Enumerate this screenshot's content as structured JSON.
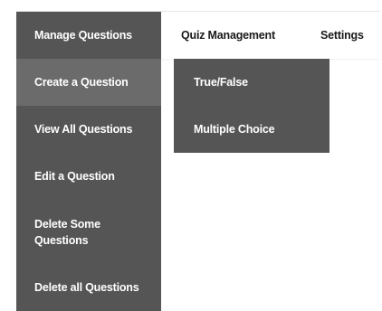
{
  "nav": {
    "items": [
      {
        "label": "Manage Questions"
      },
      {
        "label": "Quiz Management"
      },
      {
        "label": "Settings"
      }
    ]
  },
  "dropdown": {
    "items": [
      {
        "label": "Create a Question"
      },
      {
        "label": "View All Questions"
      },
      {
        "label": "Edit a Question"
      },
      {
        "label": "Delete Some Questions"
      },
      {
        "label": "Delete all Questions"
      }
    ]
  },
  "submenu": {
    "items": [
      {
        "label": "True/False"
      },
      {
        "label": "Multiple Choice"
      }
    ]
  },
  "colors": {
    "menu_bg": "#555555",
    "menu_hover_bg": "#6b6b6b",
    "nav_text": "#1a1a1a",
    "menu_text": "#ffffff"
  }
}
